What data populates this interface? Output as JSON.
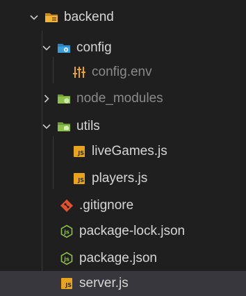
{
  "explorer": {
    "items": [
      {
        "label": "backend",
        "type": "folder",
        "expanded": true,
        "icon": "folder-open-orange-icon"
      },
      {
        "label": "config",
        "type": "folder",
        "expanded": true,
        "icon": "folder-config-icon"
      },
      {
        "label": "config.env",
        "type": "file",
        "icon": "env-tune-icon"
      },
      {
        "label": "node_modules",
        "type": "folder",
        "expanded": false,
        "icon": "folder-node-icon"
      },
      {
        "label": "utils",
        "type": "folder",
        "expanded": true,
        "icon": "folder-utils-icon"
      },
      {
        "label": "liveGames.js",
        "type": "file",
        "icon": "js-file-icon"
      },
      {
        "label": "players.js",
        "type": "file",
        "icon": "js-file-icon"
      },
      {
        "label": ".gitignore",
        "type": "file",
        "icon": "git-icon"
      },
      {
        "label": "package-lock.json",
        "type": "file",
        "icon": "nodejs-icon"
      },
      {
        "label": "package.json",
        "type": "file",
        "icon": "nodejs-icon"
      },
      {
        "label": "server.js",
        "type": "file",
        "icon": "js-file-icon",
        "selected": true
      }
    ],
    "badge_text": "JS"
  },
  "colors": {
    "background": "#1f1f1f",
    "selected_row": "#37373d",
    "folder_orange": "#e8a41c",
    "folder_blue": "#3b9fd8",
    "folder_green": "#8dc149",
    "git": "#e0522c",
    "js": "#e8a41c",
    "node_green": "#8dc149",
    "env_yellow": "#e8a41c"
  }
}
